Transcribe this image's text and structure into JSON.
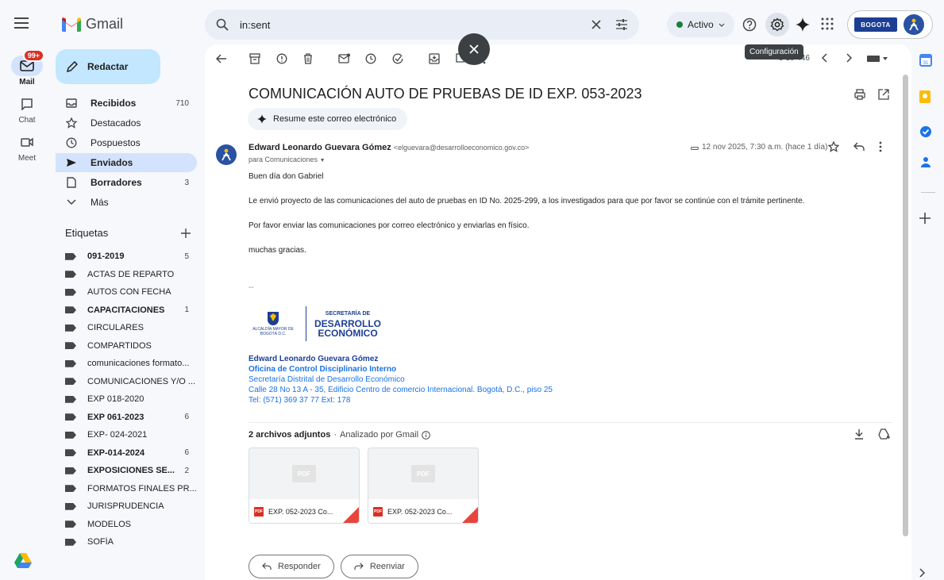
{
  "app": {
    "name": "Gmail"
  },
  "rail": {
    "items": [
      {
        "label": "Mail",
        "badge": "99+"
      },
      {
        "label": "Chat"
      },
      {
        "label": "Meet"
      }
    ]
  },
  "compose": {
    "label": "Redactar"
  },
  "nav": {
    "items": [
      {
        "label": "Recibidos",
        "count": "710"
      },
      {
        "label": "Destacados",
        "count": ""
      },
      {
        "label": "Pospuestos",
        "count": ""
      },
      {
        "label": "Enviados",
        "count": ""
      },
      {
        "label": "Borradores",
        "count": "3"
      },
      {
        "label": "Más",
        "count": ""
      }
    ]
  },
  "labels_section": {
    "title": "Etiquetas",
    "items": [
      {
        "label": "091-2019",
        "count": "5"
      },
      {
        "label": "ACTAS DE REPARTO",
        "count": ""
      },
      {
        "label": "AUTOS CON FECHA",
        "count": ""
      },
      {
        "label": "CAPACITACIONES",
        "count": "1"
      },
      {
        "label": "CIRCULARES",
        "count": ""
      },
      {
        "label": "COMPARTIDOS",
        "count": ""
      },
      {
        "label": "comunicaciones formato...",
        "count": ""
      },
      {
        "label": "COMUNICACIONES Y/O ...",
        "count": ""
      },
      {
        "label": "EXP 018-2020",
        "count": ""
      },
      {
        "label": "EXP 061-2023",
        "count": "6"
      },
      {
        "label": "EXP- 024-2021",
        "count": ""
      },
      {
        "label": "EXP-014-2024",
        "count": "6"
      },
      {
        "label": "EXPOSICIONES SE...",
        "count": "2"
      },
      {
        "label": "FORMATOS FINALES PR...",
        "count": ""
      },
      {
        "label": "JURISPRUDENCIA",
        "count": ""
      },
      {
        "label": "MODELOS",
        "count": ""
      },
      {
        "label": "SOFÍA",
        "count": ""
      }
    ]
  },
  "search": {
    "query": "in:sent"
  },
  "status": {
    "label": "Activo"
  },
  "account": {
    "org_logo_text": "BOGOTA"
  },
  "toolbar": {
    "pager": "5 de 446"
  },
  "tooltip": {
    "text": "Configuración"
  },
  "email": {
    "subject": "COMUNICACIÓN AUTO DE PRUEBAS DE ID EXP. 053-2023",
    "summarize_label": "Resume este correo electrónico",
    "sender_name": "Edward Leonardo Guevara Gómez",
    "sender_email": "<elguevara@desarrolloeconomico.gov.co>",
    "to": "para Comunicaciones",
    "date": "12 nov 2025, 7:30 a.m. (hace 1 día)",
    "body": [
      "Buen día don Gabriel",
      "Le envió proyecto de las comunicaciones del auto de pruebas en ID No. 2025-299, a los investigados para que por favor se continúe con el trámite pertinente.",
      "Por favor enviar las comunicaciones por correo electrónico y enviarlas en físico.",
      "muchas gracias."
    ],
    "sig_separator": "--",
    "logo": {
      "crest_text": "ALCALDÍA MAYOR DE BOGOTÁ D.C.",
      "line1": "SECRETARÍA DE",
      "line2": "DESARROLLO",
      "line3": "ECONÓMICO"
    },
    "signature": {
      "name": "Edward Leonardo Guevara Gómez",
      "office": "Oficina de Control Disciplinario Interno",
      "entity": "Secretaría Distrital de Desarrollo Económico",
      "address": "Calle 28 No 13 A - 35, Edificio Centro de comercio Internacional. Bogotá, D.C., piso 25",
      "phone": "Tel: (571) 369 37 77 Ext: 178"
    },
    "attachments": {
      "header": "2 archivos adjuntos",
      "scanned": "Analizado por Gmail",
      "files": [
        {
          "name": "EXP. 052-2023 Co...",
          "thumb": "PDF",
          "type": "PDF"
        },
        {
          "name": "EXP. 052-2023 Co...",
          "thumb": "PDF",
          "type": "PDF"
        }
      ]
    },
    "reply_label": "Responder",
    "forward_label": "Reenviar"
  },
  "colors": {
    "accent": "#1a73e8",
    "compose_bg": "#c2e7ff",
    "active_nav": "#d3e3fd",
    "badge": "#d93025",
    "status_dot": "#188038"
  }
}
